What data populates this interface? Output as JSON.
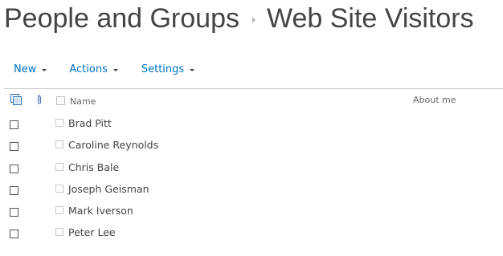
{
  "title": {
    "part1": "People and Groups",
    "part2": "Web Site Visitors"
  },
  "toolbar": {
    "new_label": "New",
    "actions_label": "Actions",
    "settings_label": "Settings"
  },
  "table": {
    "headers": {
      "name": "Name",
      "about": "About me"
    },
    "rows": [
      {
        "name": "Brad Pitt"
      },
      {
        "name": "Caroline Reynolds"
      },
      {
        "name": "Chris Bale"
      },
      {
        "name": "Joseph Geisman"
      },
      {
        "name": "Mark Iverson"
      },
      {
        "name": "Peter Lee"
      }
    ]
  },
  "colors": {
    "link": "#0072c6",
    "text": "#444444",
    "divider": "#c6c6c6"
  }
}
